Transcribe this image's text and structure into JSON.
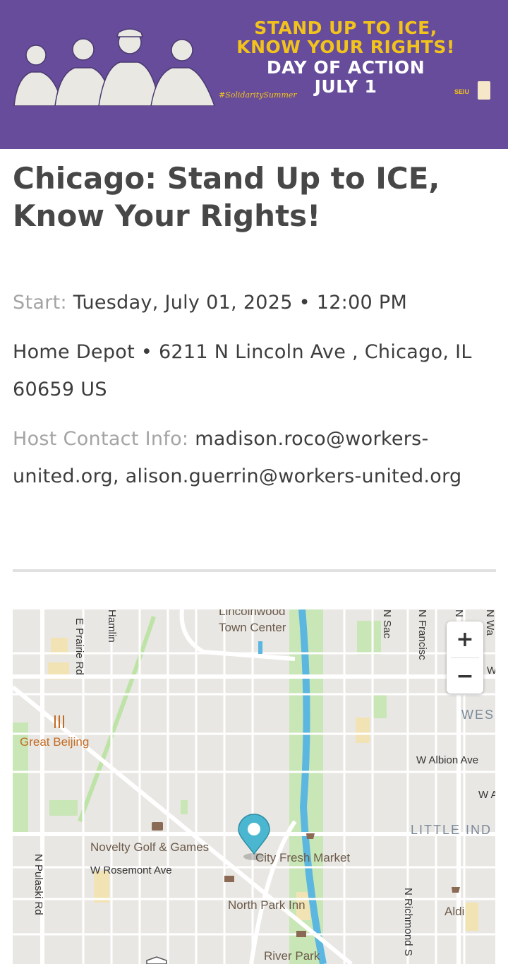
{
  "banner": {
    "line1": "STAND UP TO ICE,",
    "line2": "KNOW YOUR RIGHTS!",
    "line3": "DAY OF ACTION",
    "line4": "JULY 1",
    "hashtag": "#SolidaritySummer",
    "logo_text": "SEIU"
  },
  "event": {
    "title": "Chicago: Stand Up to ICE, Know Your Rights!",
    "start_label": "Start:",
    "start_value": "Tuesday, July 01, 2025 • 12:00 PM",
    "address": "Home Depot •  6211 N Lincoln Ave , Chicago, IL 60659 US",
    "host_label": "Host Contact Info:",
    "host_value": "madison.roco@workers-united.org, alison.guerrin@workers-united.org"
  },
  "map": {
    "zoom_in": "+",
    "zoom_out": "−",
    "labels": {
      "lincolnwood": "Lincolnwood",
      "town_center": "Town Center",
      "hamlin": "Hamlin",
      "prairie": "E Prairie Rd",
      "sacramento": "N Sac",
      "francisco": "N Francisc",
      "n_rr": "N",
      "n_wa": "N Wa",
      "w_edge": "W",
      "wes": "WES",
      "great_beijing": "Great Beijing",
      "albion": "W Albion Ave",
      "w_a": "W A",
      "little_india": "LITTLE IND",
      "novelty": "Novelty Golf & Games",
      "city_fresh": "City Fresh Market",
      "rosemont": "W Rosemont Ave",
      "north_park_inn": "North Park Inn",
      "pulaski": "N Pulaski Rd",
      "richmond": "N Richmond S",
      "aldi": "Aldi",
      "river_park": "River Park"
    }
  }
}
